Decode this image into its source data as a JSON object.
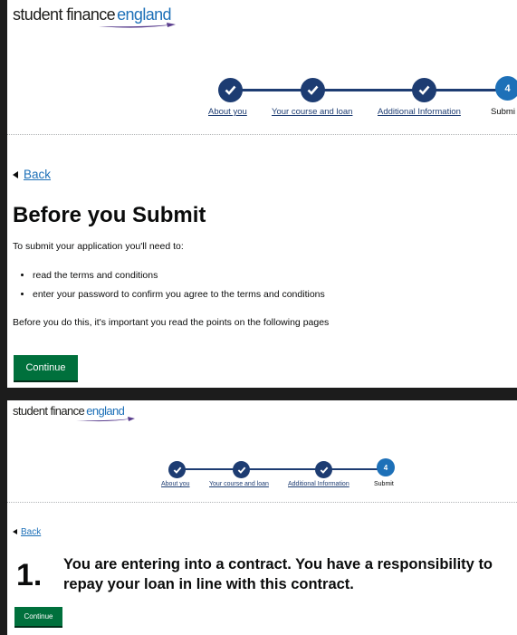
{
  "brand": {
    "word1": "student finance",
    "word2": "england",
    "colors": {
      "navy": "#1d3c72",
      "blue": "#1d70b8",
      "green": "#00703c"
    }
  },
  "progress": {
    "steps": [
      {
        "label": "About you",
        "status": "complete",
        "icon": "checkmark-icon"
      },
      {
        "label": "Your course and loan",
        "status": "complete",
        "icon": "checkmark-icon"
      },
      {
        "label": "Additional Information",
        "status": "complete",
        "icon": "checkmark-icon"
      },
      {
        "label": "Submit",
        "status": "current",
        "number": "4"
      }
    ],
    "panel1_last_label": "Submi"
  },
  "screen1": {
    "back_label": "Back",
    "title": "Before you Submit",
    "intro": "To submit your application you'll need to:",
    "bullets": [
      "read the terms and conditions",
      "enter your password to confirm you agree to the terms and conditions"
    ],
    "note": "Before you do this, it's important you read the points on the following pages",
    "continue_label": "Continue"
  },
  "screen2": {
    "back_label": "Back",
    "number": "1.",
    "contract_line1": "You are entering into a contract. You have a responsibility to",
    "contract_line2": "repay your loan in line with this contract.",
    "continue_label": "Continue"
  }
}
